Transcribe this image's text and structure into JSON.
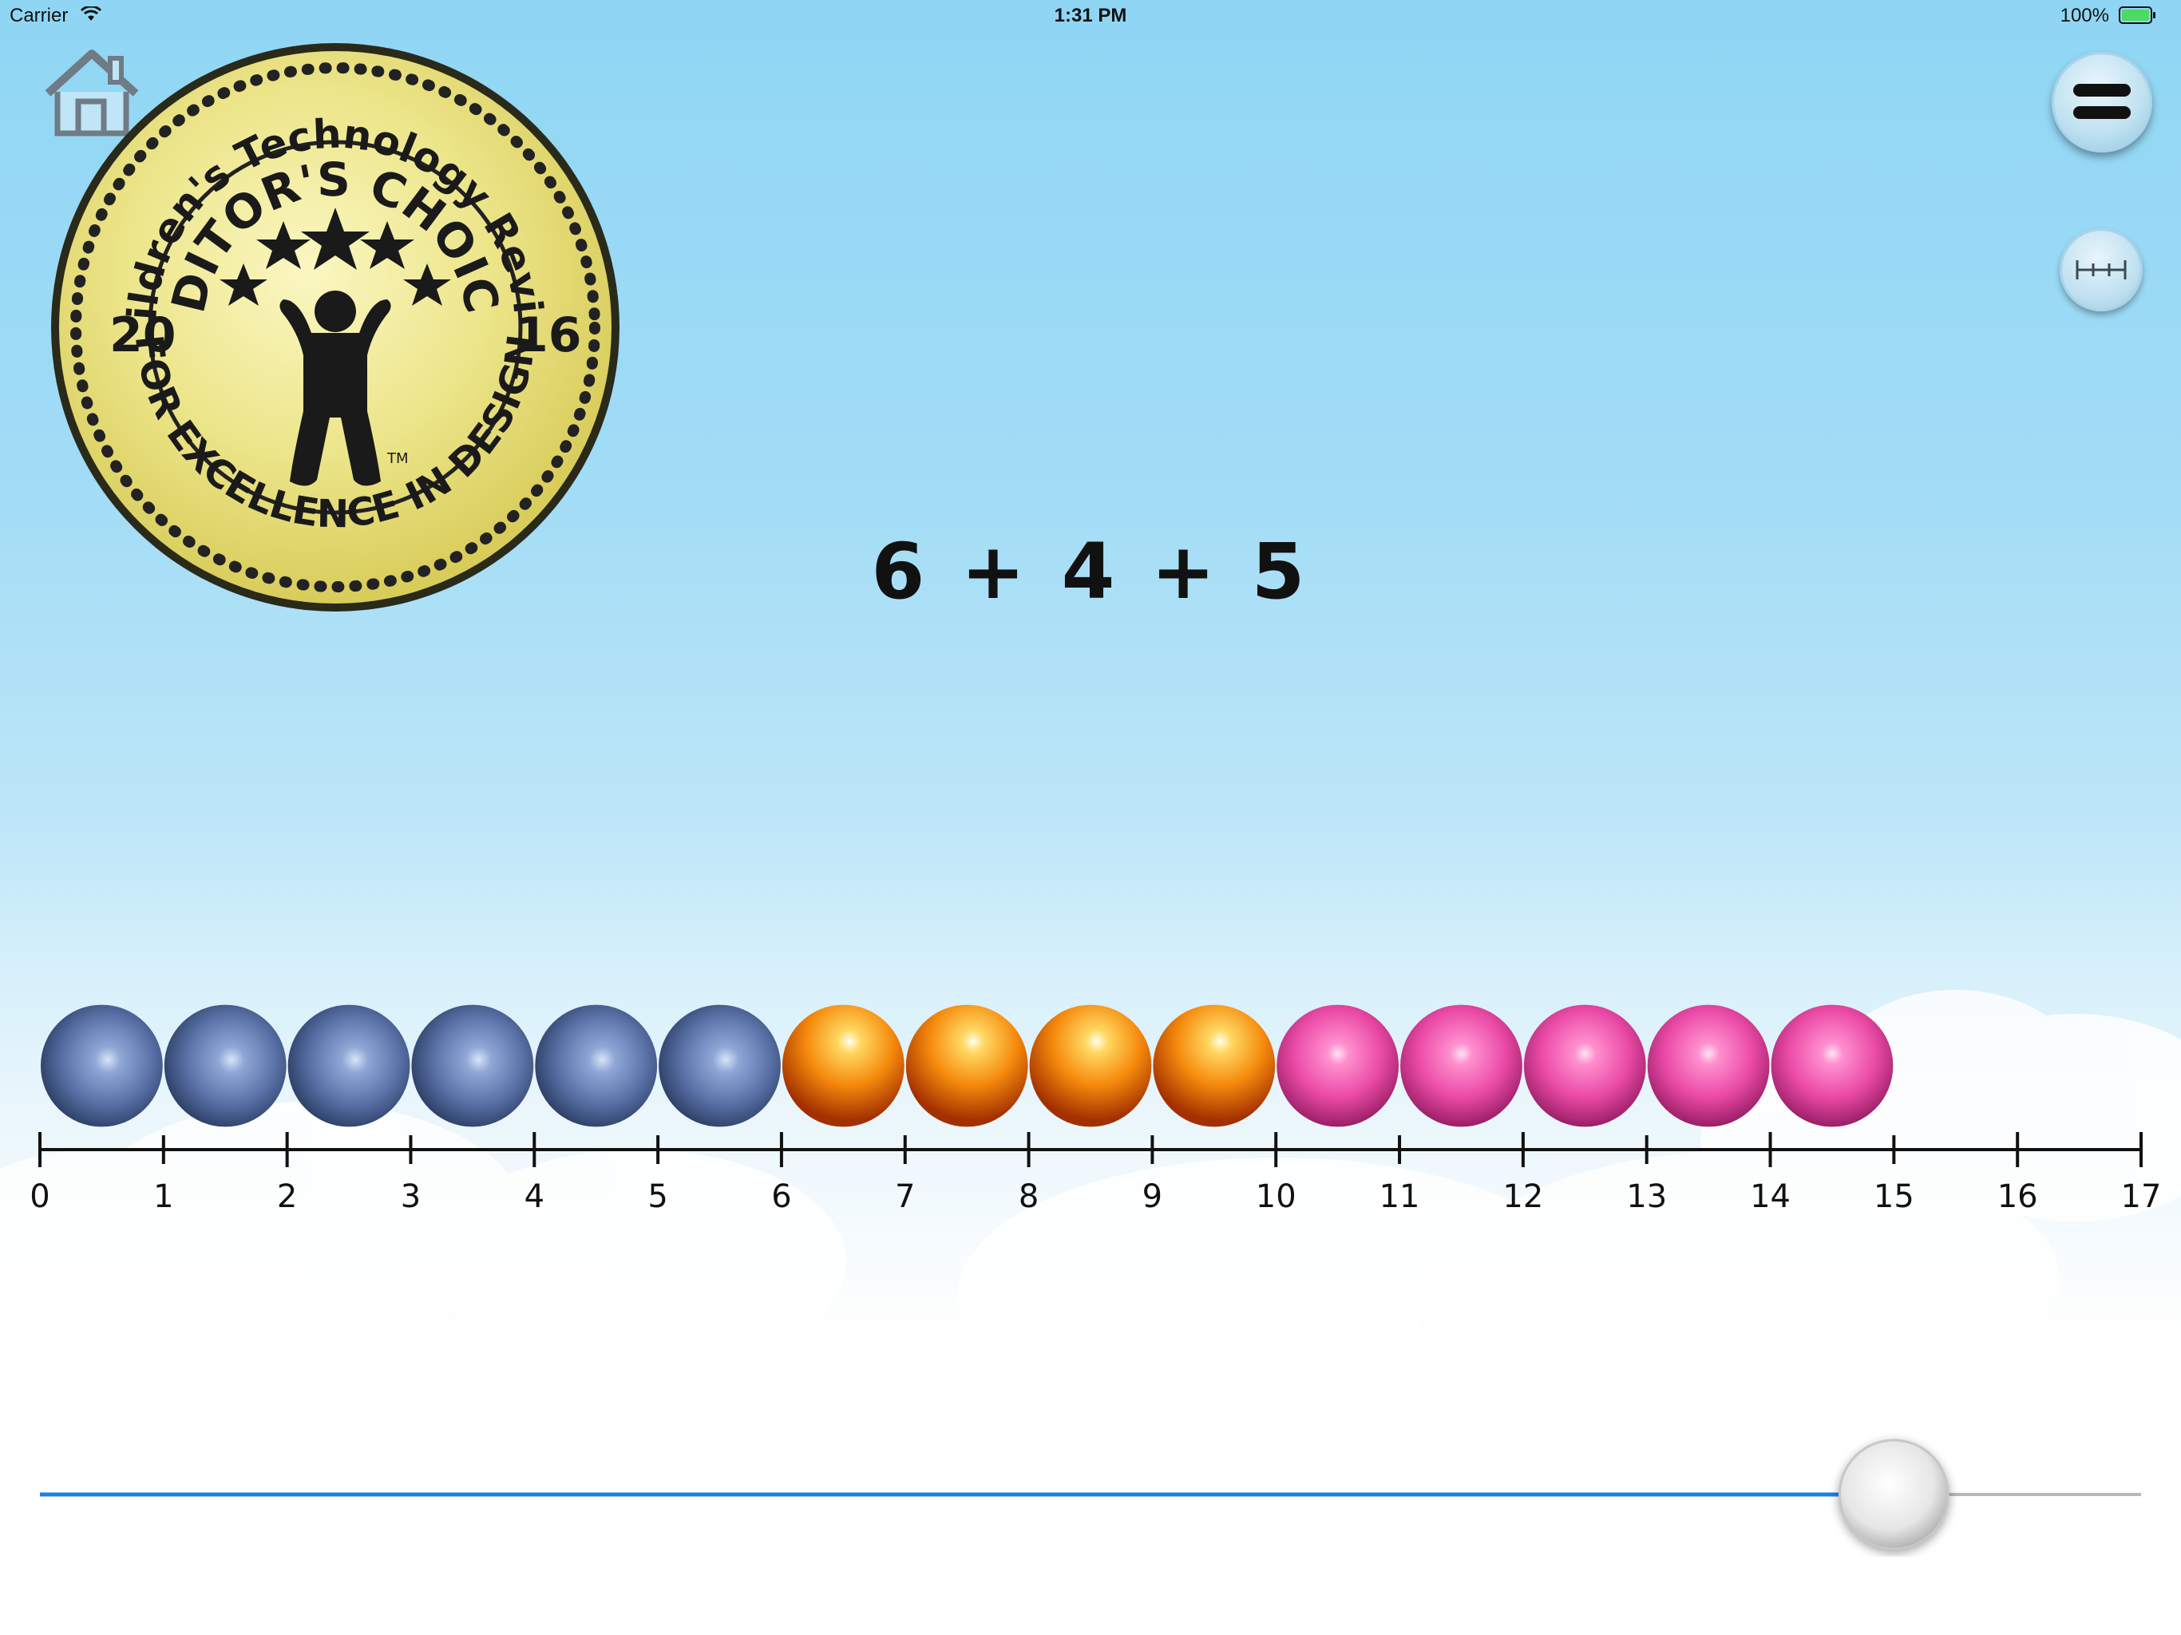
{
  "status_bar": {
    "carrier": "Carrier",
    "time": "1:31 PM",
    "battery": "100%"
  },
  "badge": {
    "top_text": "Children's Technology Review",
    "title": "EDITOR'S CHOICE",
    "year_left": "20",
    "year_right": "16",
    "bottom_text": "FOR EXCELLENCE IN DESIGN",
    "tm": "TM"
  },
  "equation": "6 + 4 + 5",
  "number_line": {
    "labels": [
      "0",
      "1",
      "2",
      "3",
      "4",
      "5",
      "6",
      "7",
      "8",
      "9",
      "10",
      "11",
      "12",
      "13",
      "14",
      "15",
      "16",
      "17"
    ],
    "min": 0,
    "max": 17
  },
  "beads": {
    "groups": [
      {
        "count": 6,
        "color": "blue"
      },
      {
        "count": 4,
        "color": "orange"
      },
      {
        "count": 5,
        "color": "pink"
      }
    ]
  },
  "slider": {
    "value": 15,
    "min": 0,
    "max": 17
  },
  "icons": {
    "home": "home-icon",
    "menu": "menu-icon",
    "ruler": "ruler-icon"
  }
}
